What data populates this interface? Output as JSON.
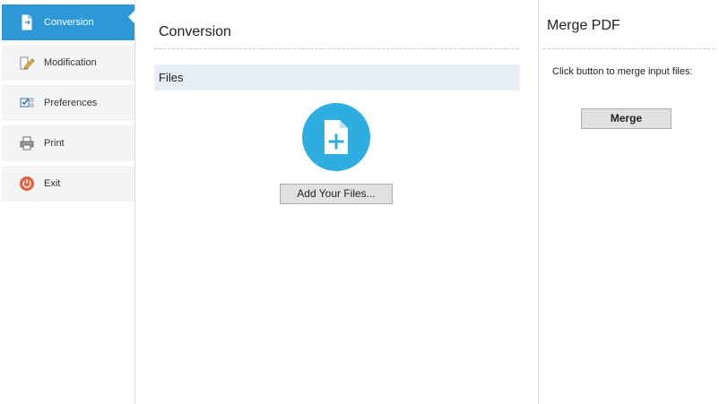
{
  "sidebar": {
    "items": [
      {
        "label": "Conversion",
        "icon": "conversion-document-icon",
        "active": true
      },
      {
        "label": "Modification",
        "icon": "edit-pencil-icon",
        "active": false
      },
      {
        "label": "Preferences",
        "icon": "checklist-icon",
        "active": false
      },
      {
        "label": "Print",
        "icon": "printer-icon",
        "active": false
      },
      {
        "label": "Exit",
        "icon": "power-icon",
        "active": false
      }
    ]
  },
  "main": {
    "title": "Conversion",
    "files_header": "Files",
    "add_files_label": "Add Your Files...",
    "add_icon": "add-file-icon"
  },
  "right_panel": {
    "title": "Merge PDF",
    "description": "Click button to merge input files:",
    "merge_label": "Merge"
  },
  "colors": {
    "accent": "#2e97d6",
    "add_circle": "#2eaee0",
    "files_header_bg": "#e6edf5",
    "sidebar_item_bg": "#f3f4f6",
    "exit_icon": "#e5603f"
  }
}
